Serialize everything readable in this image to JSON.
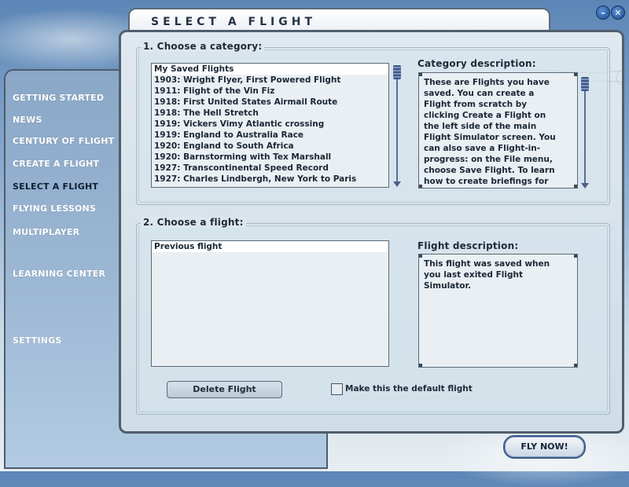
{
  "window": {
    "minimize_glyph": "–",
    "close_glyph": "✕"
  },
  "title": "SELECT A FLIGHT",
  "nav": {
    "items": [
      {
        "label": "GETTING STARTED",
        "active": false
      },
      {
        "label": "NEWS",
        "active": false
      },
      {
        "label": "CENTURY OF FLIGHT",
        "active": false
      },
      {
        "label": "CREATE A FLIGHT",
        "active": false
      },
      {
        "label": "SELECT A FLIGHT",
        "active": true
      },
      {
        "label": "FLYING LESSONS",
        "active": false
      },
      {
        "label": "MULTIPLAYER",
        "active": false
      },
      {
        "label": "LEARNING CENTER",
        "active": false
      },
      {
        "label": "SETTINGS",
        "active": false
      }
    ]
  },
  "category": {
    "heading": "1. Choose a category:",
    "items": [
      "My Saved Flights",
      "1903: Wright Flyer, First Powered Flight",
      "1911: Flight of the Vin Fiz",
      "1918: First United States Airmail Route",
      "1918: The Hell Stretch",
      "1919: Vickers Vimy Atlantic crossing",
      "1919: England to Australia Race",
      "1920: England to South Africa",
      "1920: Barnstorming with Tex Marshall",
      "1927: Transcontinental Speed Record",
      "1927: Charles Lindbergh, New York to Paris"
    ],
    "selected_index": 0,
    "description_label": "Category description:",
    "description": "These are Flights you have saved. You can create a Flight from scratch by clicking Create a Flight on the left side of the main Flight Simulator screen. You can also save a Flight-in-progress: on the File menu, choose Save Flight. To learn how to create briefings for your Flights or new categories of"
  },
  "flight": {
    "heading": "2. Choose a flight:",
    "items": [
      "Previous flight"
    ],
    "selected_index": 0,
    "description_label": "Flight description:",
    "description": "This flight was saved when you last exited Flight Simulator."
  },
  "actions": {
    "delete_label": "Delete Flight",
    "default_checkbox_label": "Make this the default flight",
    "default_checked": false,
    "fly_label": "FLY NOW!"
  },
  "colors": {
    "panel_border": "#505e6d",
    "nav_text": "#ffffff",
    "nav_active_text": "#0f1f33",
    "accent_blue": "#3c5a88"
  }
}
